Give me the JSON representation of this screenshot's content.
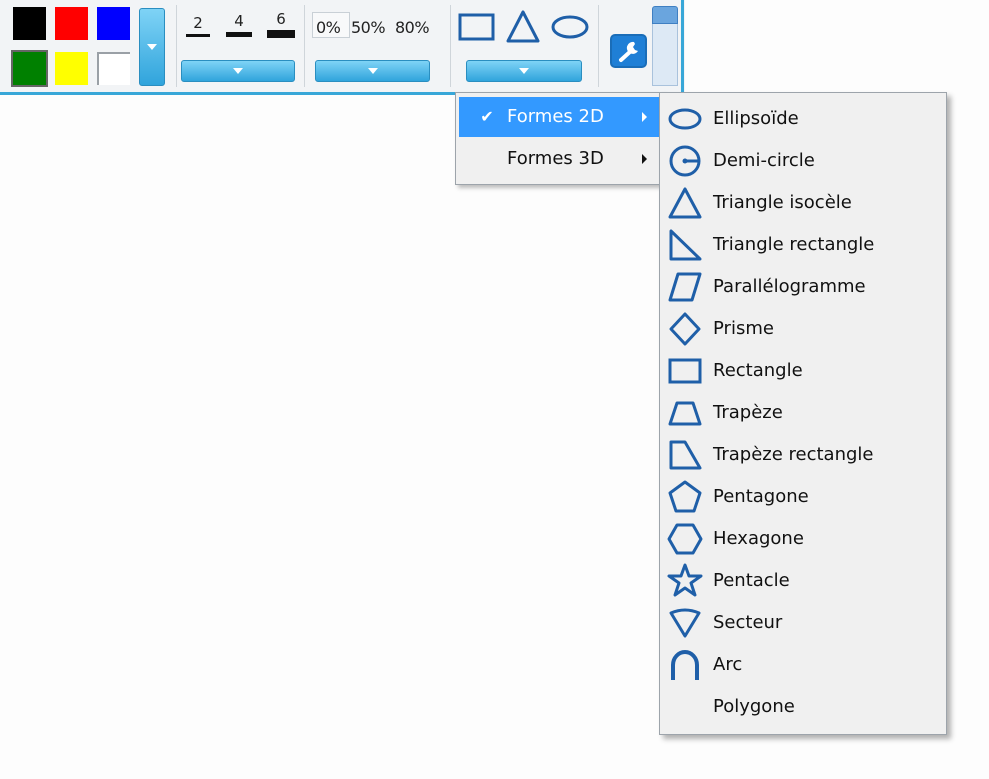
{
  "toolbar": {
    "colors": [
      "#000000",
      "#ff0000",
      "#0000ff",
      "#008000",
      "#ffff00",
      "#ffffff"
    ],
    "thickness": [
      "2",
      "4",
      "6"
    ],
    "opacity": [
      "0%",
      "50%",
      "80%"
    ],
    "shape_icons": [
      "rectangle-icon",
      "triangle-icon",
      "ellipse-icon"
    ],
    "tool_icon": "wrench-icon",
    "accent": "#38a7d8"
  },
  "menu": {
    "items": [
      {
        "label": "Formes 2D",
        "checked": true
      },
      {
        "label": "Formes 3D",
        "checked": false
      }
    ],
    "check_glyph": "✔"
  },
  "submenu": {
    "icon_color": "#1f5fa8",
    "items": [
      {
        "label": "Ellipsoïde",
        "icon": "ellipse-icon"
      },
      {
        "label": "Demi-circle",
        "icon": "half-circle-icon"
      },
      {
        "label": "Triangle isocèle",
        "icon": "isosceles-triangle-icon"
      },
      {
        "label": "Triangle rectangle",
        "icon": "right-triangle-icon"
      },
      {
        "label": "Parallélogramme",
        "icon": "parallelogram-icon"
      },
      {
        "label": "Prisme",
        "icon": "diamond-icon"
      },
      {
        "label": "Rectangle",
        "icon": "rectangle-icon"
      },
      {
        "label": "Trapèze",
        "icon": "trapezoid-icon"
      },
      {
        "label": "Trapèze rectangle",
        "icon": "right-trapezoid-icon"
      },
      {
        "label": "Pentagone",
        "icon": "pentagon-icon"
      },
      {
        "label": "Hexagone",
        "icon": "hexagon-icon"
      },
      {
        "label": "Pentacle",
        "icon": "star-icon"
      },
      {
        "label": "Secteur",
        "icon": "sector-icon"
      },
      {
        "label": "Arc",
        "icon": "arc-icon"
      },
      {
        "label": "Polygone",
        "icon": ""
      }
    ]
  }
}
